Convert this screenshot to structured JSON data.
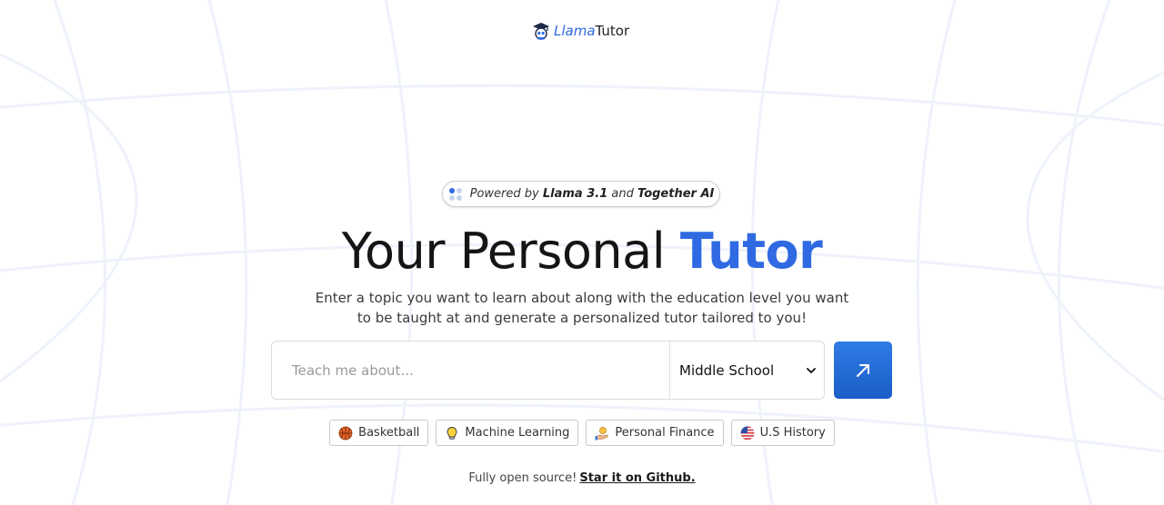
{
  "brand": {
    "name_part_1": "Llama",
    "name_part_2": "Tutor"
  },
  "badge": {
    "prefix": "Powered by",
    "model": "Llama 3.1",
    "conjunction": "and",
    "provider": "Together AI"
  },
  "hero": {
    "title_plain": "Your Personal",
    "title_accent": "Tutor"
  },
  "subtitle": "Enter a topic you want to learn about along with the education level you want to be taught at and generate a personalized tutor tailored to you!",
  "search": {
    "placeholder": "Teach me about...",
    "value": "",
    "level_selected": "Middle School"
  },
  "chips": [
    {
      "label": "Basketball",
      "icon": "basketball-icon"
    },
    {
      "label": "Machine Learning",
      "icon": "lightbulb-icon"
    },
    {
      "label": "Personal Finance",
      "icon": "money-hand-icon"
    },
    {
      "label": "U.S History",
      "icon": "us-flag-icon"
    }
  ],
  "footer": {
    "text": "Fully open source!",
    "link": "Star it on Github."
  },
  "colors": {
    "accent": "#2f6ae3",
    "button": "#1f66d4"
  }
}
